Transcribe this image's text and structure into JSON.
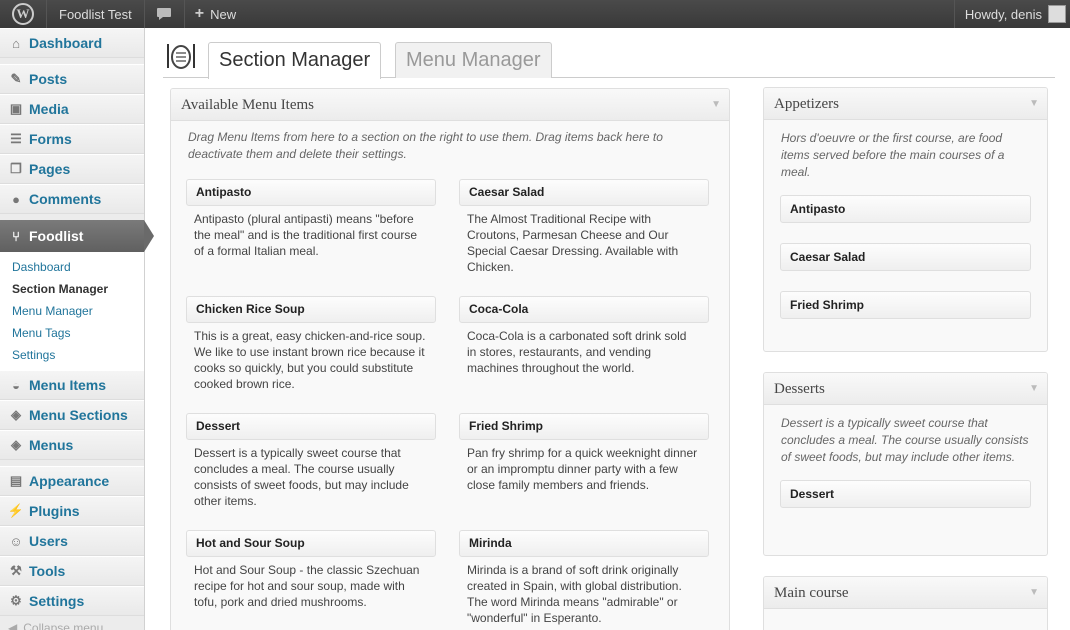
{
  "adminbar": {
    "site_name": "Foodlist Test",
    "new_label": "New",
    "howdy": "Howdy, denis"
  },
  "sidebar": {
    "items": [
      {
        "label": "Dashboard",
        "icon": "dashboard-icon"
      },
      {
        "label": "Posts",
        "icon": "pin-icon"
      },
      {
        "label": "Media",
        "icon": "media-icon"
      },
      {
        "label": "Forms",
        "icon": "forms-icon"
      },
      {
        "label": "Pages",
        "icon": "pages-icon"
      },
      {
        "label": "Comments",
        "icon": "comments-icon"
      },
      {
        "label": "Foodlist",
        "icon": "fork-knife-icon"
      },
      {
        "label": "Menu Items",
        "icon": "bowl-icon"
      },
      {
        "label": "Menu Sections",
        "icon": "sections-icon"
      },
      {
        "label": "Menus",
        "icon": "menus-icon"
      },
      {
        "label": "Appearance",
        "icon": "appearance-icon"
      },
      {
        "label": "Plugins",
        "icon": "plugins-icon"
      },
      {
        "label": "Users",
        "icon": "users-icon"
      },
      {
        "label": "Tools",
        "icon": "tools-icon"
      },
      {
        "label": "Settings",
        "icon": "settings-icon"
      }
    ],
    "submenu": [
      "Dashboard",
      "Section Manager",
      "Menu Manager",
      "Menu Tags",
      "Settings"
    ],
    "collapse": "Collapse menu"
  },
  "tabs": {
    "active": "Section Manager",
    "inactive": "Menu Manager"
  },
  "available": {
    "title": "Available Menu Items",
    "hint": "Drag Menu Items from here to a section on the right to use them. Drag items back here to deactivate them and delete their settings.",
    "items": [
      {
        "title": "Antipasto",
        "desc": "Antipasto (plural antipasti) means \"before the meal\" and is the traditional first course of a formal Italian meal."
      },
      {
        "title": "Caesar Salad",
        "desc": "The Almost Traditional Recipe with Croutons, Parmesan Cheese and Our Special Caesar Dressing. Available with Chicken."
      },
      {
        "title": "Chicken Rice Soup",
        "desc": "This is a great, easy chicken-and-rice soup. We like to use instant brown rice because it cooks so quickly, but you could substitute cooked brown rice."
      },
      {
        "title": "Coca-Cola",
        "desc": "Coca-Cola is a carbonated soft drink sold in stores, restaurants, and vending machines throughout the world."
      },
      {
        "title": "Dessert",
        "desc": "Dessert is a typically sweet course that concludes a meal. The course usually consists of sweet foods, but may include other items."
      },
      {
        "title": "Fried Shrimp",
        "desc": "Pan fry shrimp for a quick weeknight dinner or an impromptu dinner party with a few close family members and friends."
      },
      {
        "title": "Hot and Sour Soup",
        "desc": "Hot and Sour Soup - the classic Szechuan recipe for hot and sour soup, made with tofu, pork and dried mushrooms."
      },
      {
        "title": "Mirinda",
        "desc": "Mirinda is a brand of soft drink originally created in Spain, with global distribution. The word Mirinda means \"admirable\" or \"wonderful\" in Esperanto."
      }
    ]
  },
  "sections": [
    {
      "title": "Appetizers",
      "hint": "Hors d'oeuvre or the first course, are food items served before the main courses of a meal.",
      "items": [
        "Antipasto",
        "Caesar Salad",
        "Fried Shrimp"
      ]
    },
    {
      "title": "Desserts",
      "hint": "Dessert is a typically sweet course that concludes a meal. The course usually consists of sweet foods, but may include other items.",
      "items": [
        "Dessert"
      ]
    },
    {
      "title": "Main course"
    }
  ]
}
